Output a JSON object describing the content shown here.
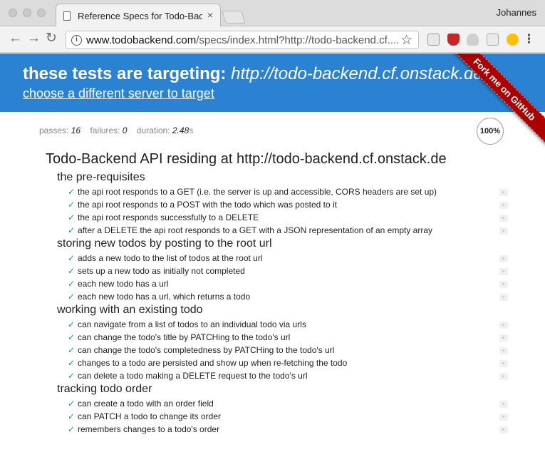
{
  "browser": {
    "tab_title": "Reference Specs for Todo-Backend",
    "tab_close": "×",
    "profile_name": "Johannes",
    "url_host": "www.todobackend.com",
    "url_rest": "/specs/index.html?http://todo-backend.cf....",
    "nav": {
      "back": "←",
      "forward": "→",
      "reload": "↻"
    },
    "star": "☆",
    "menu": "⋮",
    "info": "i"
  },
  "hero": {
    "heading_bold": "these tests are targeting:",
    "heading_url": "http://todo-backend.cf.onstack.de",
    "link": "choose a different server to target",
    "ribbon": "Fork me on GitHub"
  },
  "stats": {
    "passes_label": "passes:",
    "passes": "16",
    "failures_label": "failures:",
    "failures": "0",
    "duration_label": "duration:",
    "duration": "2.48",
    "duration_unit": "s",
    "progress": "100%"
  },
  "suite_title": "Todo-Backend API residing at http://todo-backend.cf.onstack.de",
  "check_glyph": "✓",
  "replay_glyph": "▸",
  "groups": [
    {
      "title": "the pre-requisites",
      "tests": [
        "the api root responds to a GET (i.e. the server is up and accessible, CORS headers are set up)",
        "the api root responds to a POST with the todo which was posted to it",
        "the api root responds successfully to a DELETE",
        "after a DELETE the api root responds to a GET with a JSON representation of an empty array"
      ]
    },
    {
      "title": "storing new todos by posting to the root url",
      "tests": [
        "adds a new todo to the list of todos at the root url",
        "sets up a new todo as initially not completed",
        "each new todo has a url",
        "each new todo has a url, which returns a todo"
      ]
    },
    {
      "title": "working with an existing todo",
      "tests": [
        "can navigate from a list of todos to an individual todo via urls",
        "can change the todo's title by PATCHing to the todo's url",
        "can change the todo's completedness by PATCHing to the todo's url",
        "changes to a todo are persisted and show up when re-fetching the todo",
        "can delete a todo making a DELETE request to the todo's url"
      ]
    },
    {
      "title": "tracking todo order",
      "tests": [
        "can create a todo with an order field",
        "can PATCH a todo to change its order",
        "remembers changes to a todo's order"
      ]
    }
  ],
  "colors": {
    "hero_bg": "#2b82d2",
    "ribbon": "#aa0000",
    "check": "#00a68c"
  }
}
